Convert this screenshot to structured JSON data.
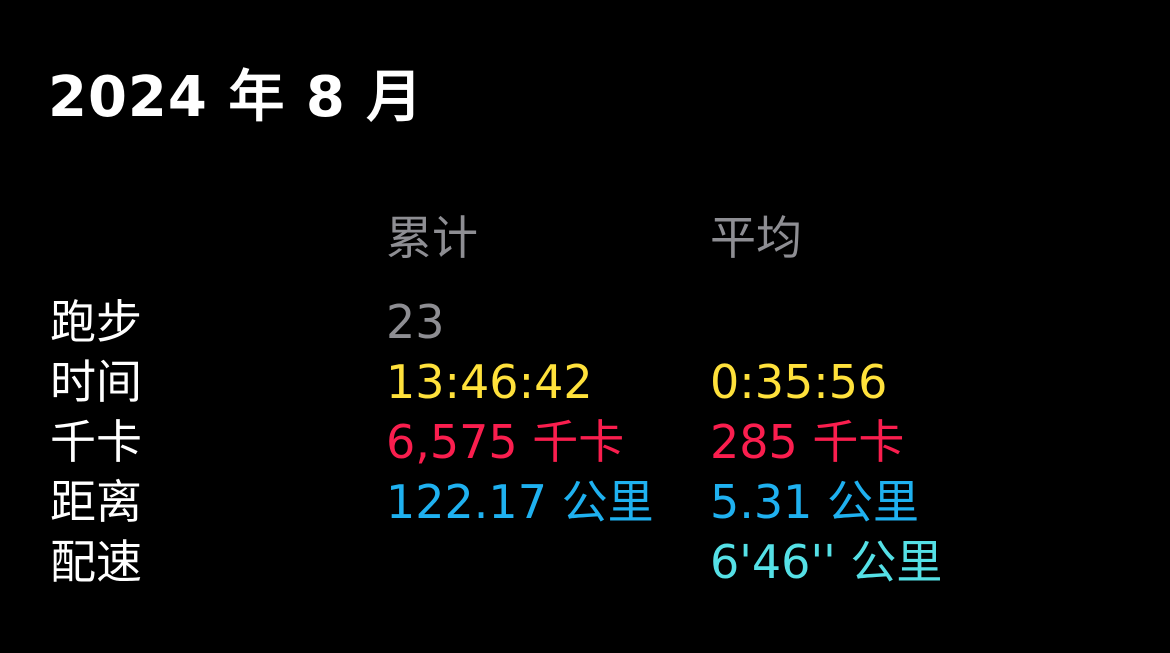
{
  "title": "2024 年 8 月",
  "headers": {
    "total": "累计",
    "average": "平均"
  },
  "rows": [
    {
      "label": "跑步",
      "total": "23",
      "average": ""
    },
    {
      "label": "时间",
      "total": "13:46:42",
      "average": "0:35:56"
    },
    {
      "label": "千卡",
      "total": "6,575 千卡",
      "average": "285 千卡"
    },
    {
      "label": "距离",
      "total": "122.17 公里",
      "average": "5.31 公里"
    },
    {
      "label": "配速",
      "total": "",
      "average": "6'46'' 公里"
    }
  ],
  "colors": {
    "background": "#000000",
    "label": "#ffffff",
    "header": "#8e8e93",
    "workouts": "#8e8e93",
    "time": "#ffe13b",
    "calories": "#fa1e4e",
    "distance": "#1fb1f0",
    "pace": "#55e0e6"
  }
}
